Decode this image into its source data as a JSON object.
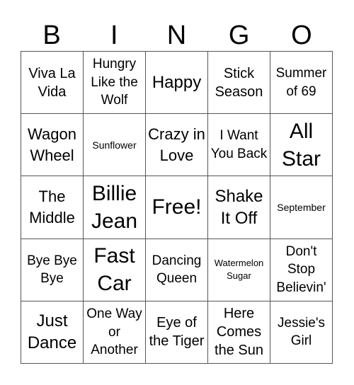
{
  "header": {
    "letters": [
      "B",
      "I",
      "N",
      "G",
      "O"
    ]
  },
  "cells": [
    [
      "Viva La Vida",
      "Hungry Like the Wolf",
      "Happy",
      "Stick Season",
      "Summer of 69"
    ],
    [
      "Wagon Wheel",
      "Sunflower",
      "Crazy in Love",
      "I Want You Back",
      "All Star"
    ],
    [
      "The Middle",
      "Billie Jean",
      "Free!",
      "Shake It Off",
      "September"
    ],
    [
      "Bye Bye Bye",
      "Fast Car",
      "Dancing Queen",
      "Watermelon Sugar",
      "Don't Stop Believin'"
    ],
    [
      "Just Dance",
      "One Way or Another",
      "Eye of the Tiger",
      "Here Comes the Sun",
      "Jessie's Girl"
    ]
  ]
}
